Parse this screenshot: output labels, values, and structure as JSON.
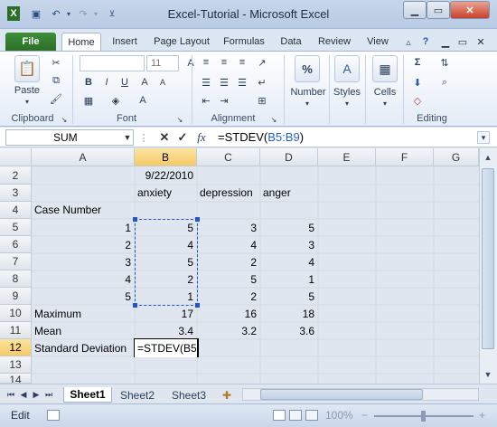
{
  "window": {
    "title": "Excel-Tutorial - Microsoft Excel"
  },
  "ribbon_tabs": [
    "File",
    "Home",
    "Insert",
    "Page Layout",
    "Formulas",
    "Data",
    "Review",
    "View"
  ],
  "ribbon": {
    "font_size": "11",
    "groups": {
      "clipboard": "Clipboard",
      "font": "Font",
      "alignment": "Alignment",
      "editing": "Editing"
    },
    "paste_label": "Paste",
    "number_label": "Number",
    "number_symbol": "%",
    "styles_label": "Styles",
    "cells_label": "Cells"
  },
  "formula_bar": {
    "name_box": "SUM",
    "formula_prefix": "=STDEV(",
    "formula_ref": "B5:B9",
    "formula_suffix": ")"
  },
  "columns": [
    "A",
    "B",
    "C",
    "D",
    "E",
    "F",
    "G"
  ],
  "rows": [
    "2",
    "3",
    "4",
    "5",
    "6",
    "7",
    "8",
    "9",
    "10",
    "11",
    "12",
    "13",
    "14"
  ],
  "cells": {
    "B2": "9/22/2010",
    "B3": "anxiety",
    "C3": "depression",
    "D3": "anger",
    "A4": "Case Number",
    "A5": "1",
    "B5": "5",
    "C5": "3",
    "D5": "5",
    "A6": "2",
    "B6": "4",
    "C6": "4",
    "D6": "3",
    "A7": "3",
    "B7": "5",
    "C7": "2",
    "D7": "4",
    "A8": "4",
    "B8": "2",
    "C8": "5",
    "D8": "1",
    "A9": "5",
    "B9": "1",
    "C9": "2",
    "D9": "5",
    "A10": "Maximum",
    "B10": "17",
    "C10": "16",
    "D10": "18",
    "A11": "Mean",
    "B11": "3.4",
    "C11": "3.2",
    "D11": "3.6",
    "A12": "Standard Deviation",
    "B12": "=STDEV(B5"
  },
  "sheets": [
    "Sheet1",
    "Sheet2",
    "Sheet3"
  ],
  "status": {
    "mode": "Edit",
    "zoom": "100%"
  },
  "colors": {
    "file_tab": "#2a6f27",
    "selection_border": "#2255cc",
    "header_selected": "#f5c966"
  }
}
